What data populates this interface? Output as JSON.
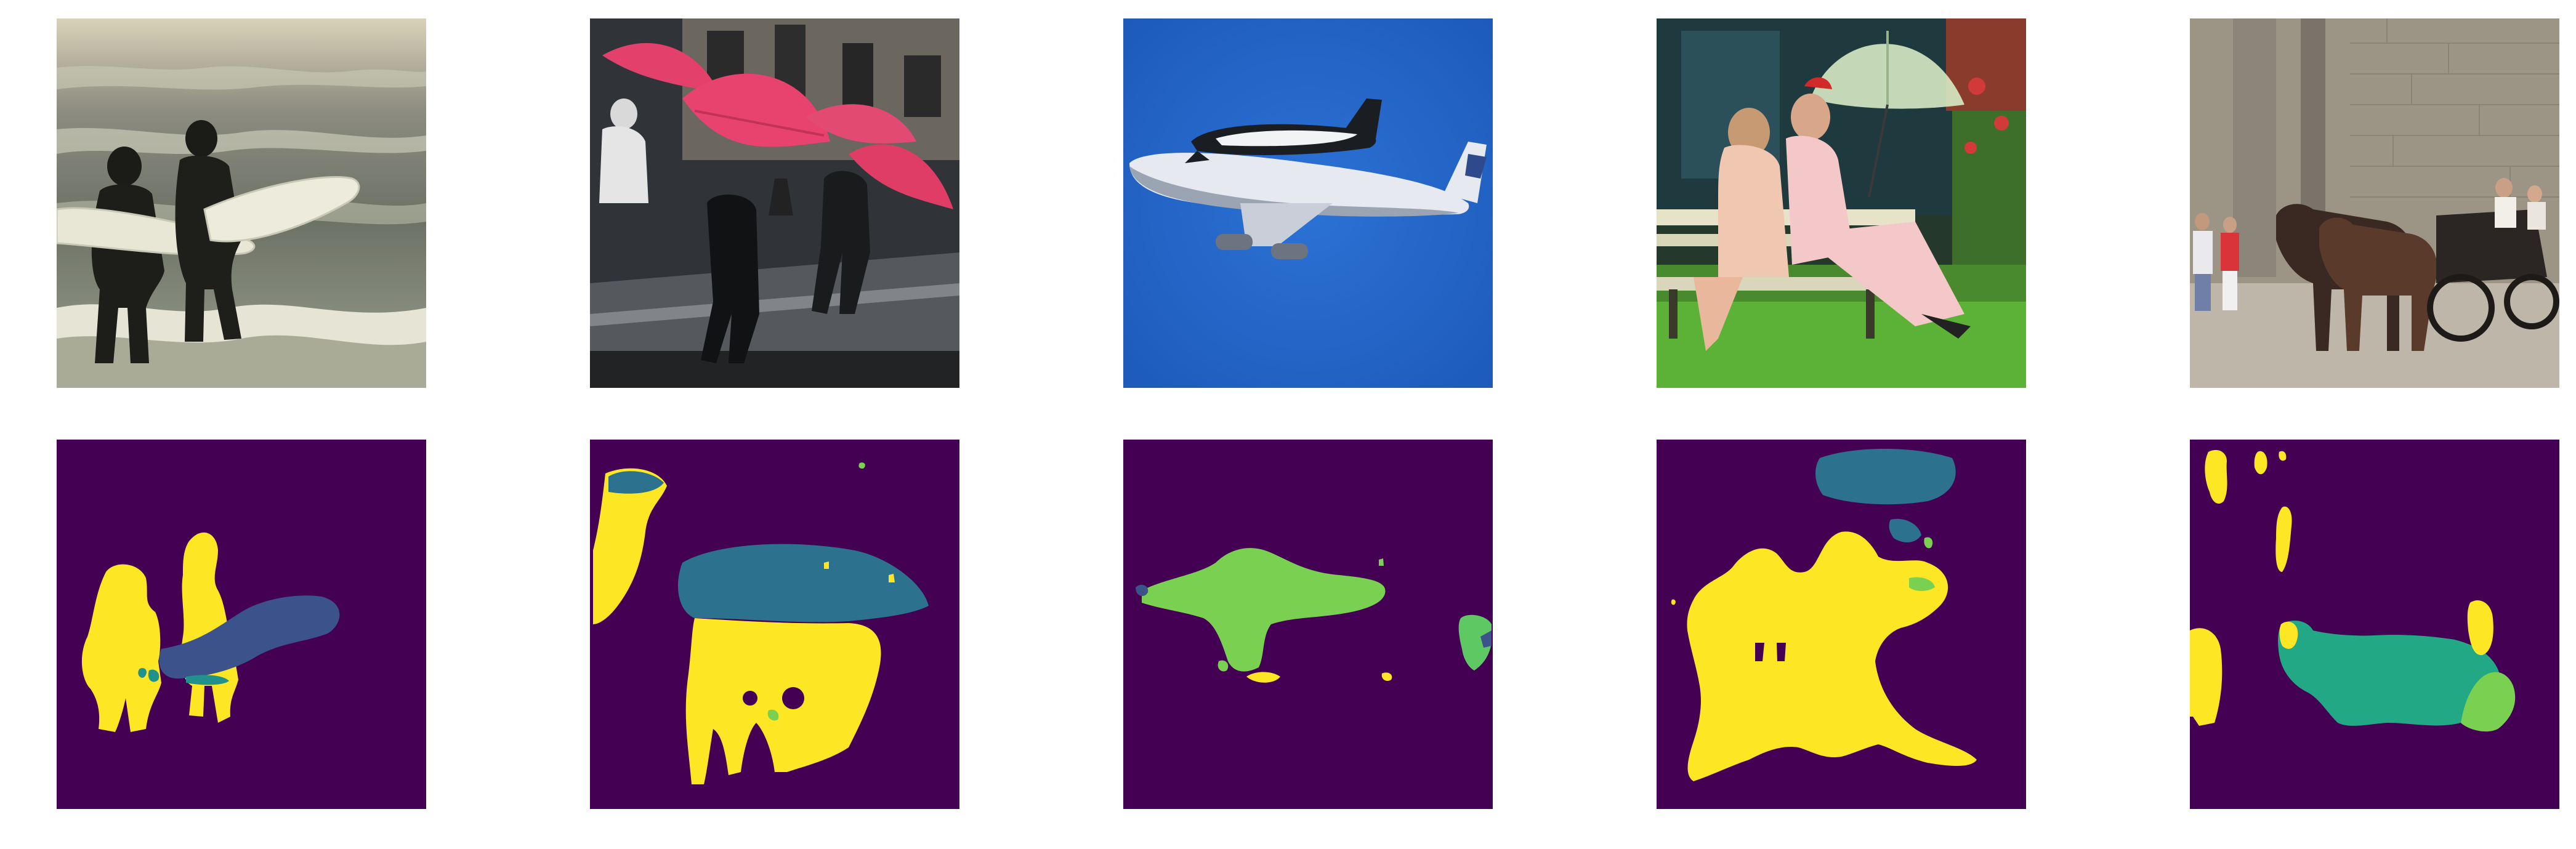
{
  "figure": {
    "rows": 2,
    "columns": 5
  },
  "photos": [
    {
      "id": "photo-surfers",
      "subject": "surfers",
      "palette": [
        "#6f7468",
        "#bfc3ae",
        "#1c1c18",
        "#e7e6d8"
      ]
    },
    {
      "id": "photo-umbrellas",
      "subject": "pink-umbrellas",
      "palette": [
        "#2f3438",
        "#e0406a",
        "#1a1a1e",
        "#6b6f76"
      ]
    },
    {
      "id": "photo-airplane",
      "subject": "airplane-carrying-shuttle",
      "palette": [
        "#1f5fbf",
        "#dfe3ea",
        "#1b2430",
        "#2a6ad0"
      ]
    },
    {
      "id": "photo-bench",
      "subject": "women-on-bench-with-umbrella",
      "palette": [
        "#2a4a2a",
        "#62b13a",
        "#f0c0b0",
        "#c8e6c0"
      ]
    },
    {
      "id": "photo-carriage",
      "subject": "horse-carriage",
      "palette": [
        "#a49c8e",
        "#8a8478",
        "#3a2a22",
        "#d9d3c7"
      ]
    }
  ],
  "masks": [
    {
      "id": "mask-surfers",
      "colors": [
        "#440154",
        "#fde725",
        "#3b528b",
        "#21918c"
      ]
    },
    {
      "id": "mask-umbrellas",
      "colors": [
        "#440154",
        "#fde725",
        "#2c728e",
        "#7ad151"
      ]
    },
    {
      "id": "mask-airplane",
      "colors": [
        "#440154",
        "#7ad151",
        "#3b528b",
        "#fde725",
        "#5ec962"
      ]
    },
    {
      "id": "mask-bench",
      "colors": [
        "#440154",
        "#fde725",
        "#2c728e",
        "#7ad151"
      ]
    },
    {
      "id": "mask-carriage",
      "colors": [
        "#440154",
        "#fde725",
        "#22a884",
        "#7ad151"
      ]
    }
  ]
}
